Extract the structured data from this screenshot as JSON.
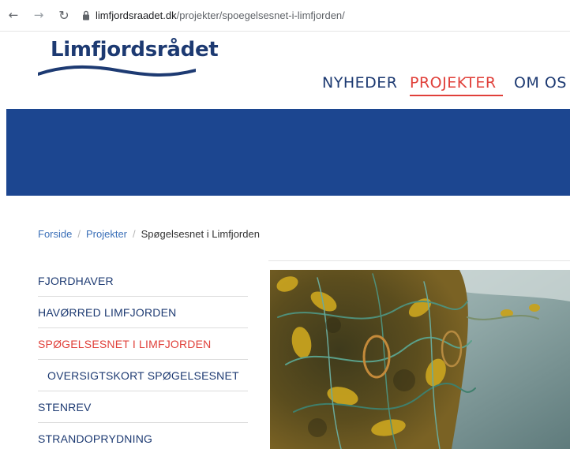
{
  "browser": {
    "back_icon": "arrow-left-icon",
    "forward_icon": "arrow-right-icon",
    "reload_icon": "reload-icon",
    "url_domain": "limfjordsraadet.dk",
    "url_path": "/projekter/spoegelsesnet-i-limfjorden/"
  },
  "site": {
    "logo_text": "Limfjordsrådet",
    "brand_color": "#1d3a72",
    "accent_color": "#e0403a",
    "hero_color": "#1c4690"
  },
  "mainnav": {
    "items": [
      {
        "label": "NYHEDER",
        "active": false
      },
      {
        "label": "PROJEKTER",
        "active": true
      },
      {
        "label": "OM OS",
        "active": false
      }
    ]
  },
  "breadcrumb": {
    "home": "Forside",
    "parent": "Projekter",
    "current": "Spøgelsesnet i Limfjorden",
    "separator": "/"
  },
  "sidemenu": {
    "items": [
      {
        "label": "FJORDHAVER"
      },
      {
        "label": "HAVØRRED LIMFJORDEN"
      },
      {
        "label": "SPØGELSESNET I LIMFJORDEN",
        "active": true
      },
      {
        "label": "OVERSIGTSKORT SPØGELSESNET",
        "sub": true
      },
      {
        "label": "STENREV"
      },
      {
        "label": "STRANDOPRYDNING"
      }
    ]
  }
}
